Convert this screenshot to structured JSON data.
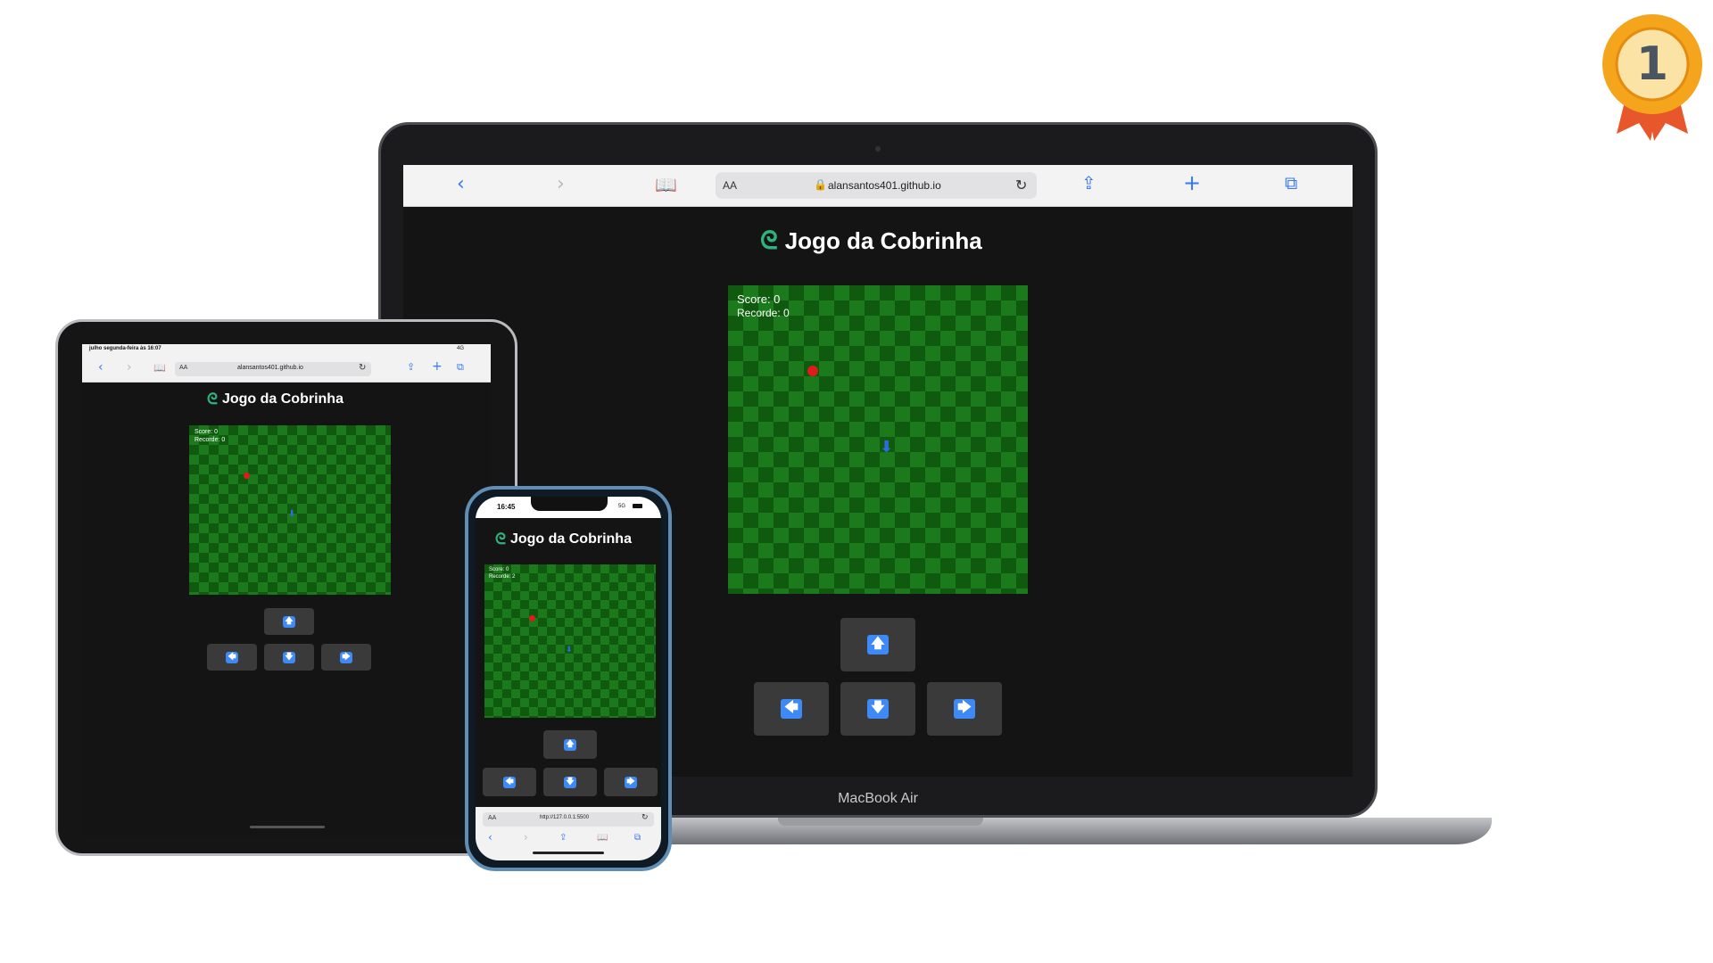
{
  "app": {
    "title": "Jogo da Cobrinha",
    "logo_icon": "snake-logo-icon",
    "score_text": "Score: 0",
    "recorde_text": "Recorde: 0",
    "recorde_text_phone": "Recorde: 2",
    "controls": {
      "up": "🡅",
      "down": "🡇",
      "left": "🡄",
      "right": "🡆"
    }
  },
  "laptop": {
    "url": "alansantos401.github.io",
    "aa": "AA",
    "brand": "MacBook Air"
  },
  "tablet": {
    "status_left": "julho segunda-feira às 16:07",
    "status_right": "4G",
    "url": "alansantos401.github.io",
    "aa": "AA"
  },
  "phone": {
    "time": "16:45",
    "network": "5G",
    "url": "http://127.0.0.1:5500",
    "aa": "AA"
  },
  "badge": {
    "number": "1",
    "icon": "first-place-medal-icon"
  },
  "colors": {
    "board_dark": "#0f5a0f",
    "board_light": "#1b7a1b",
    "food": "#e01b1b",
    "snake": "#2d6cdf",
    "logo": "#2fb37e",
    "accent": "#3478f6",
    "medal": "#f4a51c"
  }
}
